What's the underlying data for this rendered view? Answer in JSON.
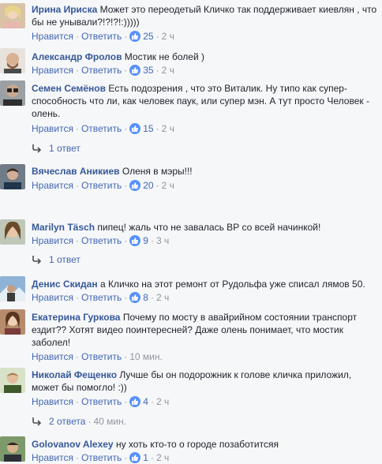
{
  "ui": {
    "like_label": "Нравится",
    "reply_label": "Ответить",
    "dot": "·",
    "like_icon": "thumbs-up-icon",
    "reply_arrow_icon": "reply-arrow-icon",
    "accent_color": "#365899",
    "like_badge_color": "#5890ff"
  },
  "comments": [
    {
      "author": "Ирина Ириска",
      "text": "Может это переодетый Кличко так поддерживает киевлян , что бы не унывали?!?!?!:)))))",
      "likes": "25",
      "time": "2 ч"
    },
    {
      "author": "Александр Фролов",
      "text": "Мостик не болей )",
      "likes": "35",
      "time": "2 ч"
    },
    {
      "author": "Семен Семёнов",
      "text": "Есть подозрения , что это Виталик. Ну типо как супер-способность что ли, как человек паук, или супер мэн. А тут просто Человек - олень.",
      "likes": "15",
      "time": "2 ч",
      "replies": "1 ответ"
    },
    {
      "author": "Вячеслав Аникиев",
      "text": "Оленя в мэры!!!",
      "likes": "20",
      "time": "2 ч"
    },
    {
      "author": "Marilyn Täsch",
      "text": "пипец! жаль что не завалась ВР со всей начинкой!",
      "likes": "9",
      "time": "3 ч",
      "replies": "1 ответ"
    },
    {
      "author": "Денис Скидан",
      "text": "а Кличко на этот ремонт от Рудольфа уже списал лямов 50.",
      "likes": "8",
      "time": "2 ч"
    },
    {
      "author": "Екатерина Гуркова",
      "text": "Почему по мосту в авайрийном состоянии транспорт ездит?? Хотят видео поинтересней? Даже олень понимает, что мостик заболел!",
      "time": "10 мин."
    },
    {
      "author": "Николай Фещенко",
      "text": "Лучше бы он подорожник к голове кличка приложил, может бы помогло! :))",
      "likes": "4",
      "time": "2 ч",
      "replies": "2 ответа",
      "replies_time": "40 мин."
    },
    {
      "author": "Golovanov Alexey",
      "text": "ну хоть кто-то о городе позаботитсяя",
      "likes": "1",
      "time": "2 ч"
    }
  ]
}
